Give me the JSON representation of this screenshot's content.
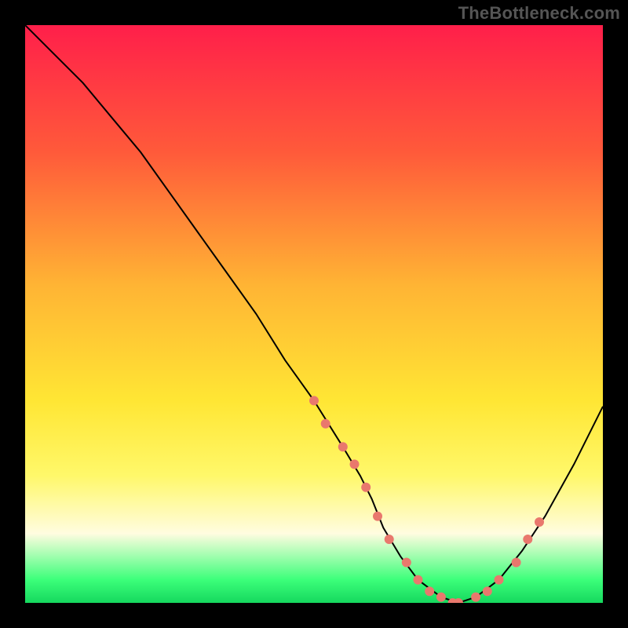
{
  "watermark": "TheBottleneck.com",
  "chart_data": {
    "type": "line",
    "title": "",
    "xlabel": "",
    "ylabel": "",
    "xlim": [
      0,
      100
    ],
    "ylim": [
      0,
      100
    ],
    "x": [
      0,
      5,
      10,
      15,
      20,
      25,
      30,
      35,
      40,
      45,
      50,
      55,
      58,
      60,
      62,
      65,
      68,
      72,
      75,
      78,
      82,
      86,
      90,
      95,
      100
    ],
    "y": [
      100,
      95,
      90,
      84,
      78,
      71,
      64,
      57,
      50,
      42,
      35,
      27,
      22,
      18,
      13,
      8,
      4,
      1,
      0,
      1,
      4,
      9,
      15,
      24,
      34
    ],
    "markers": {
      "x": [
        50,
        52,
        55,
        57,
        59,
        61,
        63,
        66,
        68,
        70,
        72,
        74,
        75,
        78,
        80,
        82,
        85,
        87,
        89
      ],
      "y": [
        35,
        31,
        27,
        24,
        20,
        15,
        11,
        7,
        4,
        2,
        1,
        0,
        0,
        1,
        2,
        4,
        7,
        11,
        14
      ]
    }
  }
}
